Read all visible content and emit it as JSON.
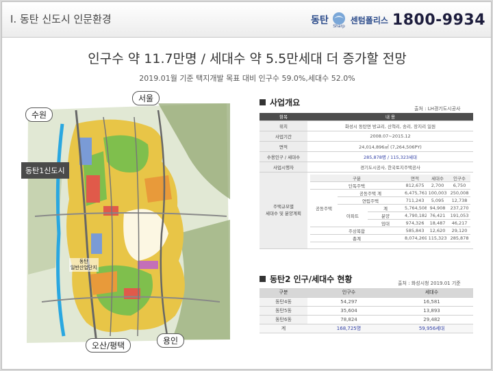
{
  "header": {
    "section_title": "Ⅰ. 동탄 신도시 인문환경",
    "brand_name": "동탄",
    "brand_logo_text": "Sharp",
    "brand_sub": "센텀폴리스",
    "brand_phone": "1800-9934"
  },
  "headline": "인구수 약 11.7만명 / 세대수 약 5.5만세대 더 증가할 전망",
  "subline": "2019.01월 기준 택지개발 목표 대비 인구수 59.0%,세대수 52.0%",
  "map": {
    "labels": {
      "seoul": "서울",
      "suwon": "수원",
      "dongtan1": "동탄1신도시",
      "industrial_line1": "동탄",
      "industrial_line2": "일반산업단지",
      "osan": "오산/평택",
      "yongin": "용인"
    }
  },
  "overview": {
    "title": "사업개요",
    "source": "출처 : LH경기도시공사",
    "headers": [
      "항목",
      "내 용"
    ],
    "rows": [
      {
        "label": "위치",
        "value": "화성시 동탄면 방교리, 산척리, 송리, 장지리 일원"
      },
      {
        "label": "사업기간",
        "value": "2008.07~2015.12"
      },
      {
        "label": "면적",
        "value": "24,014,896㎡ (7,264,506PY)"
      },
      {
        "label": "수용인구 / 세대수",
        "value": "285,878명 / 115,323세대"
      },
      {
        "label": "사업시행자",
        "value": "경기도시공사, 한국토지주택공사"
      }
    ],
    "plan_label_line1": "주택규모별",
    "plan_label_line2": "세대수 및 분양계획",
    "plan_headers": [
      "구분",
      "면적",
      "세대수",
      "인구수"
    ],
    "plan_rows": {
      "detached": {
        "label": "단독주택",
        "area": "812,675",
        "households": "2,700",
        "population": "6,750"
      },
      "apt_total": {
        "label": "공동주택 계",
        "area": "6,475,761",
        "households": "100,003",
        "population": "250,008"
      },
      "row_house": {
        "label": "연립주택",
        "area": "711,243",
        "households": "5,095",
        "population": "12,738"
      },
      "apt_total2": {
        "label": "계",
        "area": "5,764,508",
        "households": "94,908",
        "population": "237,270"
      },
      "apt_sale": {
        "label": "분양",
        "area": "4,790,182",
        "households": "76,421",
        "population": "191,053"
      },
      "apt_rent": {
        "label": "임대",
        "area": "974,326",
        "households": "18,487",
        "population": "46,217"
      },
      "mixed": {
        "label": "주상복합",
        "area": "585,843",
        "households": "12,620",
        "population": "29,120"
      },
      "total": {
        "label": "총계",
        "area": "8,074,269",
        "households": "115,323",
        "population": "285,878"
      }
    },
    "group_apartment": "공동주택",
    "group_apt": "아파트"
  },
  "population": {
    "title": "동탄2 인구/세대수 현황",
    "source": "출처 : 화성시청 2019.01 기준",
    "headers": [
      "구분",
      "인구수",
      "세대수"
    ],
    "rows": [
      {
        "label": "동탄4동",
        "population": "54,297",
        "households": "16,581"
      },
      {
        "label": "동탄5동",
        "population": "35,604",
        "households": "13,893"
      },
      {
        "label": "동탄6동",
        "population": "78,824",
        "households": "29,482"
      }
    ],
    "total": {
      "label": "계",
      "population": "168,725명",
      "households": "59,956세대"
    }
  },
  "colors": {
    "accent_blue": "#2f3ea5",
    "brand_blue": "#2a4a8a",
    "dark_header": "#4d4d4d"
  }
}
